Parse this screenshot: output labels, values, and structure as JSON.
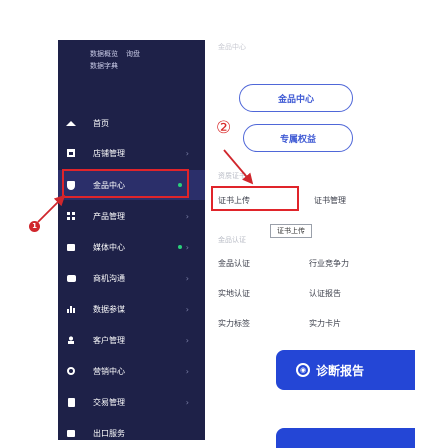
{
  "sidebar": {
    "top_links": [
      {
        "items": [
          "数据概览",
          "询盘"
        ]
      },
      {
        "items": [
          "数据字典"
        ]
      }
    ],
    "items": [
      {
        "label": "首页",
        "icon": "home-icon"
      },
      {
        "label": "店铺管理",
        "icon": "store-icon"
      },
      {
        "label": "金品中心",
        "icon": "shield-icon",
        "active": true,
        "dot": true
      },
      {
        "label": "产品管理",
        "icon": "grid-icon"
      },
      {
        "label": "媒体中心",
        "icon": "media-icon",
        "dot": true
      },
      {
        "label": "商机沟通",
        "icon": "chat-icon"
      },
      {
        "label": "数据参谋",
        "icon": "bar-chart-icon"
      },
      {
        "label": "客户管理",
        "icon": "user-icon"
      },
      {
        "label": "营销中心",
        "icon": "coin-icon"
      },
      {
        "label": "交易管理",
        "icon": "card-icon"
      },
      {
        "label": "出口服务",
        "icon": "export-icon"
      }
    ]
  },
  "panel": {
    "heading": "金品中心",
    "pill_1": "金品中心",
    "pill_2": "专属权益",
    "section_1": "资质证书",
    "cert_upload": "证书上传",
    "cert_manage": "证书管理",
    "tooltip": "证书上传",
    "section_2": "金品认证",
    "grid": [
      [
        "金品认证",
        "行业竞争力"
      ],
      [
        "实地认证",
        "认证报告"
      ],
      [
        "实力标签",
        "实力卡片"
      ]
    ],
    "banner": "诊断报告"
  },
  "annotations": {
    "marker_1": "1",
    "marker_2": "②"
  },
  "colors": {
    "sidebar_bg": "#1e2148",
    "accent": "#2446d6",
    "highlight": "#e0242a",
    "active_dot": "#29d07a"
  }
}
